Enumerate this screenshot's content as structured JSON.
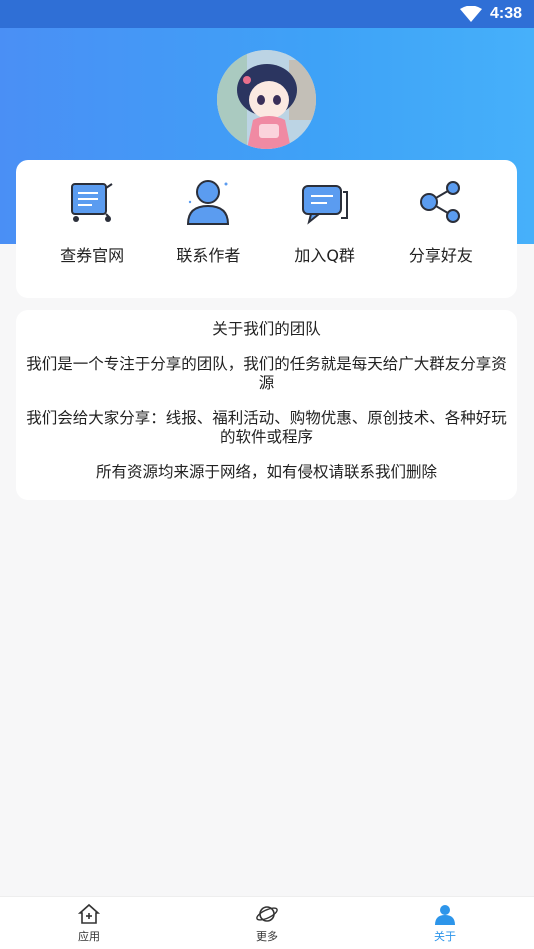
{
  "status_bar": {
    "time": "4:38"
  },
  "actions": [
    {
      "label": "查券官网",
      "icon": "cart-icon"
    },
    {
      "label": "联系作者",
      "icon": "person-icon"
    },
    {
      "label": "加入Q群",
      "icon": "chat-icon"
    },
    {
      "label": "分享好友",
      "icon": "share-icon"
    }
  ],
  "about": {
    "title": "关于我们的团队",
    "lines": [
      "我们是一个专注于分享的团队，我们的任务就是每天给广大群友分享资源",
      "我们会给大家分享：线报、福利活动、购物优惠、原创技术、各种好玩的软件或程序",
      "所有资源均来源于网络，如有侵权请联系我们删除"
    ]
  },
  "bottom_nav": [
    {
      "label": "应用",
      "icon": "home-icon",
      "active": false
    },
    {
      "label": "更多",
      "icon": "planet-icon",
      "active": false
    },
    {
      "label": "关于",
      "icon": "user-icon",
      "active": true
    }
  ],
  "colors": {
    "accent": "#2d95ea",
    "header_start": "#4a8ff5",
    "header_end": "#46b0fa"
  }
}
